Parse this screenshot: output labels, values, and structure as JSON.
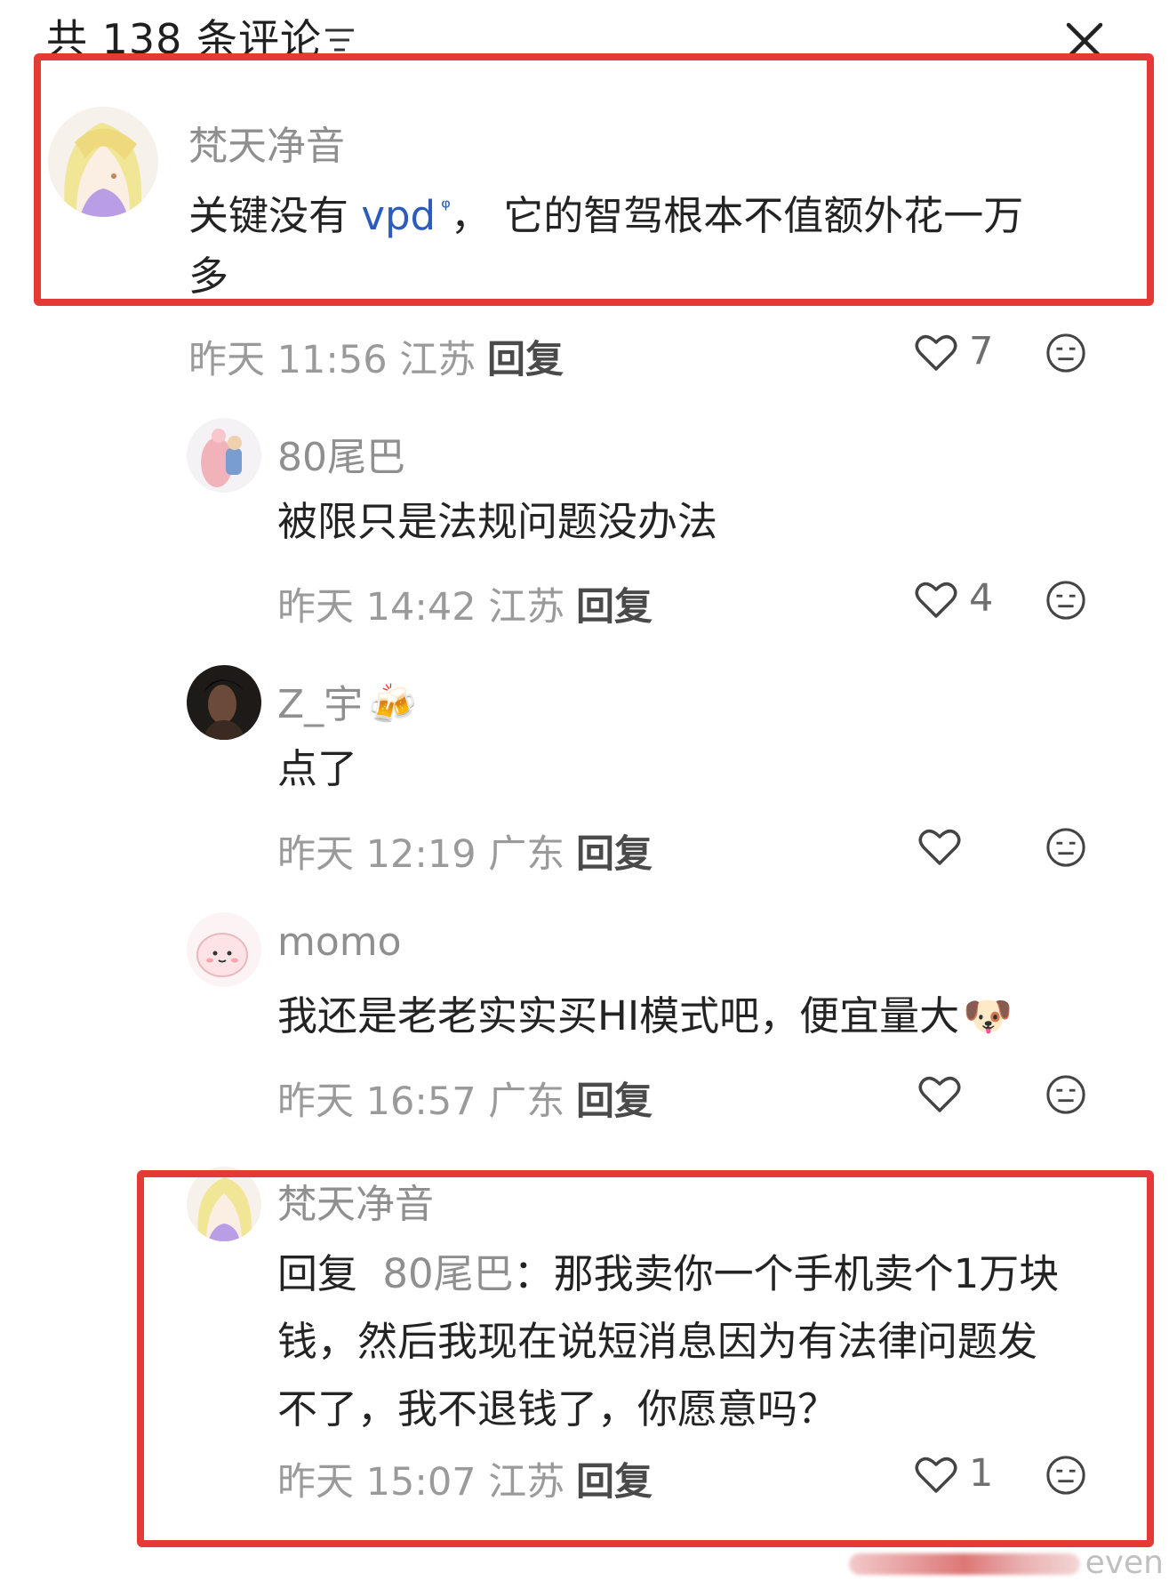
{
  "header": {
    "title": "共 138 条评论",
    "sort_icon": "sort-lines-icon",
    "close_icon": "close-x-icon"
  },
  "comments": [
    {
      "user": "梵天净音",
      "text_before": "关键没有 ",
      "link": "vpd",
      "link_mark": "ᵠ",
      "text_after": "， 它的智驾根本不值额外花一万",
      "text_line2": "多",
      "time": "昨天 11:56 江苏",
      "reply": "回复",
      "likes": "7"
    },
    {
      "user": "80尾巴",
      "text": "被限只是法规问题没办法",
      "time": "昨天 14:42 江苏",
      "reply": "回复",
      "likes": "4"
    },
    {
      "user": "Z_宇",
      "user_emoji": "🍻",
      "text": "点了",
      "time": "昨天 12:19 广东",
      "reply": "回复",
      "likes": ""
    },
    {
      "user": "momo",
      "text": "我还是老老实实买HI模式吧，便宜量大",
      "text_emoji": "🐶",
      "time": "昨天 16:57 广东",
      "reply": "回复",
      "likes": ""
    },
    {
      "user": "梵天净音",
      "reply_prefix": "回复",
      "reply_target": "80尾巴",
      "text_line1": "：那我卖你一个手机卖个1万块",
      "text_line2": "钱，然后我现在说短消息因为有法律问题发",
      "text_line3": "不了，我不退钱了，你愿意吗？",
      "time": "昨天 15:07 江苏",
      "reply": "回复",
      "likes": "1"
    }
  ],
  "icons": {
    "like": "heart-outline-icon",
    "dislike": "meh-face-icon"
  },
  "watermark": "even",
  "colors": {
    "highlight": "#e53935",
    "link": "#2d5bbd",
    "secondary_text": "#9a9a9a"
  }
}
